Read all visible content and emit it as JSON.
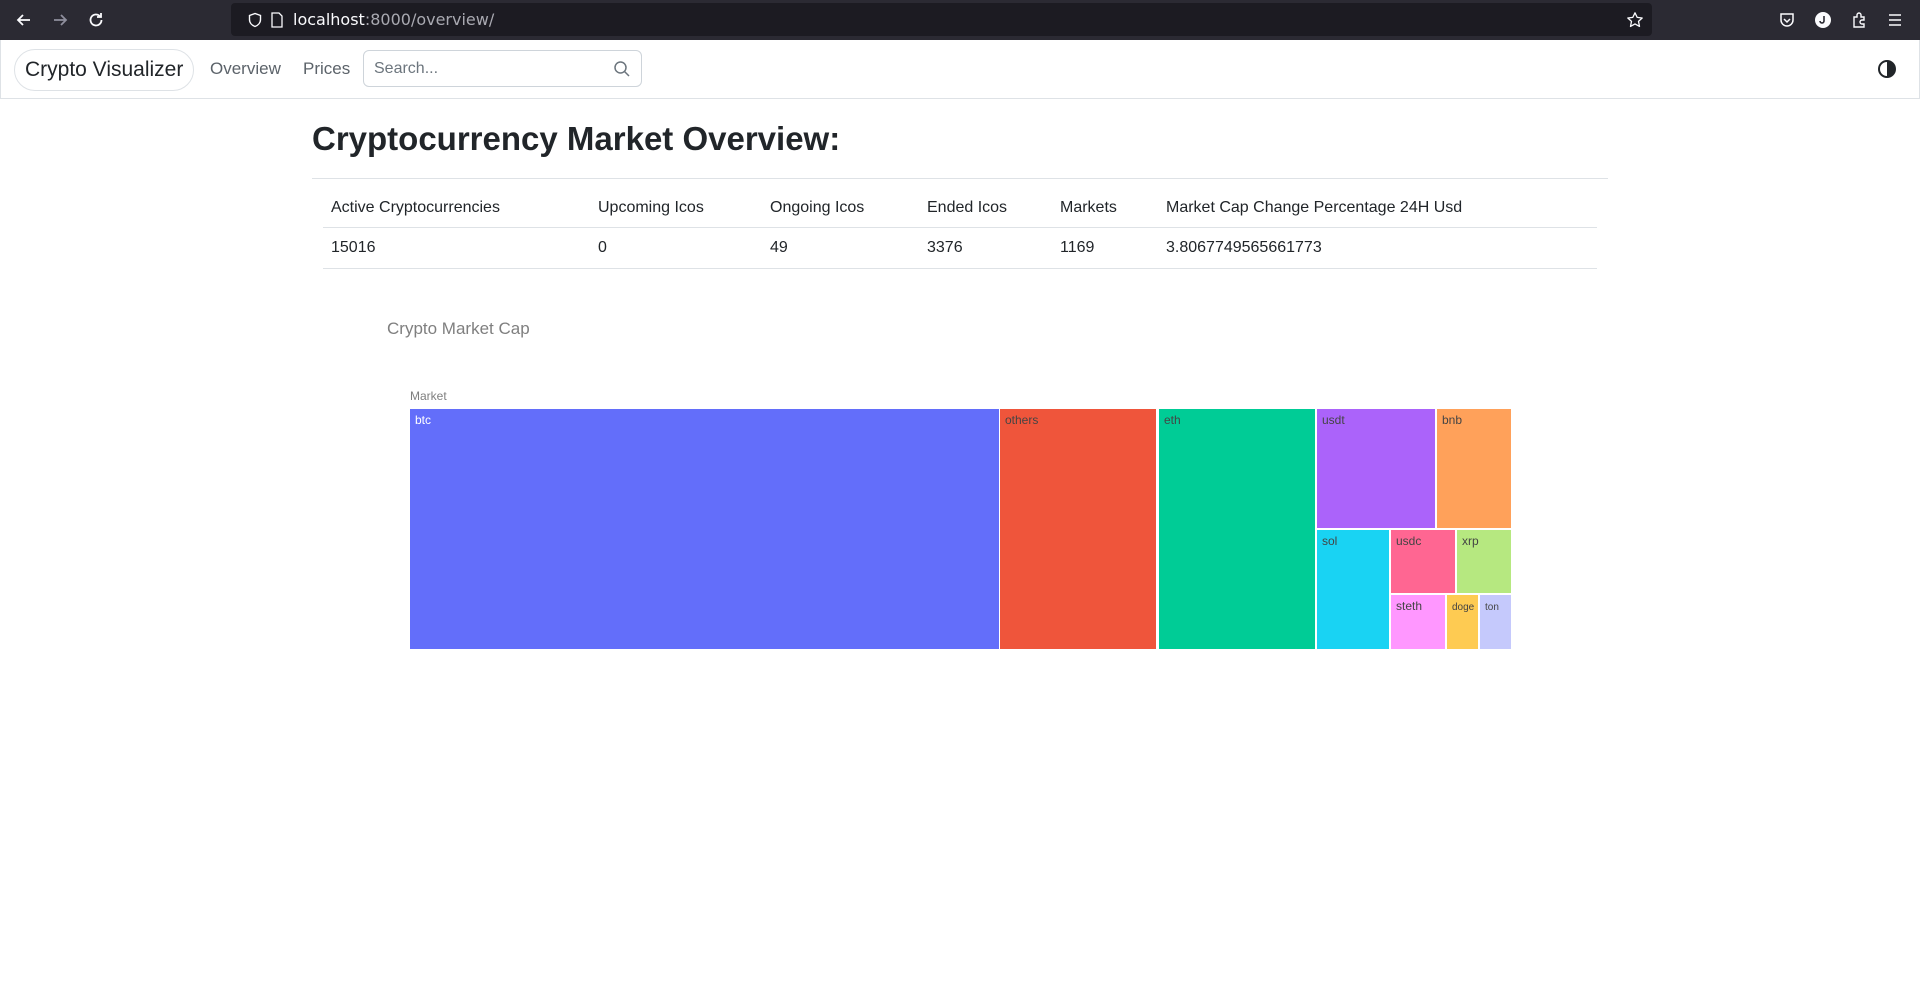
{
  "browser": {
    "url_host": "localhost",
    "url_rest": ":8000/overview/"
  },
  "navbar": {
    "brand": "Crypto Visualizer",
    "links": [
      {
        "label": "Overview"
      },
      {
        "label": "Prices"
      }
    ],
    "search_placeholder": "Search..."
  },
  "main": {
    "title": "Cryptocurrency Market Overview:",
    "table": {
      "headers": [
        "Active Cryptocurrencies",
        "Upcoming Icos",
        "Ongoing Icos",
        "Ended Icos",
        "Markets",
        "Market Cap Change Percentage 24H Usd"
      ],
      "row": [
        "15016",
        "0",
        "49",
        "3376",
        "1169",
        "3.8067749565661773"
      ]
    }
  },
  "chart_data": {
    "type": "treemap",
    "title": "Crypto Market Cap",
    "root_label": "Market",
    "tiles": [
      {
        "label": "btc",
        "color": "#636efa"
      },
      {
        "label": "others",
        "color": "#ef553b"
      },
      {
        "label": "eth",
        "color": "#00cc96"
      },
      {
        "label": "usdt",
        "color": "#ab63fa"
      },
      {
        "label": "bnb",
        "color": "#ffa15a"
      },
      {
        "label": "sol",
        "color": "#19d3f3"
      },
      {
        "label": "usdc",
        "color": "#ff6692"
      },
      {
        "label": "xrp",
        "color": "#b6e880"
      },
      {
        "label": "steth",
        "color": "#ff97ff"
      },
      {
        "label": "doge",
        "color": "#fecb52"
      },
      {
        "label": "ton",
        "color": "#c5c9fc"
      }
    ]
  }
}
